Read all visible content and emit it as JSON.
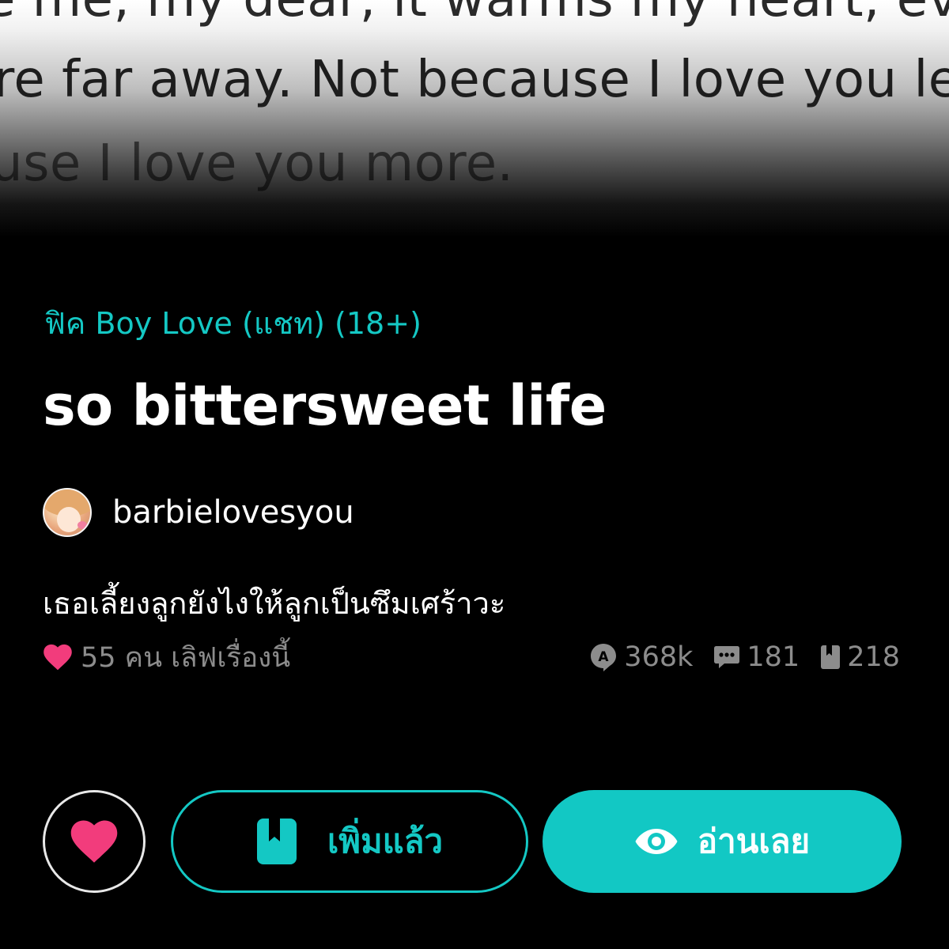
{
  "cover": {
    "quote_lines": [
      "e me, my dear, it warms my heart, ev",
      "re far away. Not because I love you les",
      "use I love you more."
    ]
  },
  "story": {
    "category": "ฟิค Boy Love (แชท) (18+)",
    "title": "so bittersweet life",
    "author": "barbielovesyou",
    "synopsis": "เธอเลี้ยงลูกยังไงให้ลูกเป็นซึมเศร้าวะ"
  },
  "loves": {
    "text": "55 คน เลิฟเรื่องนี้"
  },
  "stats": {
    "reads": "368k",
    "comments": "181",
    "bookmarks": "218"
  },
  "actions": {
    "added_label": "เพิ่มแล้ว",
    "read_label": "อ่านเลย"
  },
  "colors": {
    "accent": "#14c8c4",
    "heart": "#f23c7c",
    "background": "#000000",
    "muted_text": "#8c8c8c"
  },
  "icons": {
    "heart": "heart-icon",
    "reads": "read-count-icon",
    "comments": "comment-icon",
    "bookmarks": "bookmark-icon",
    "eye": "eye-icon"
  }
}
